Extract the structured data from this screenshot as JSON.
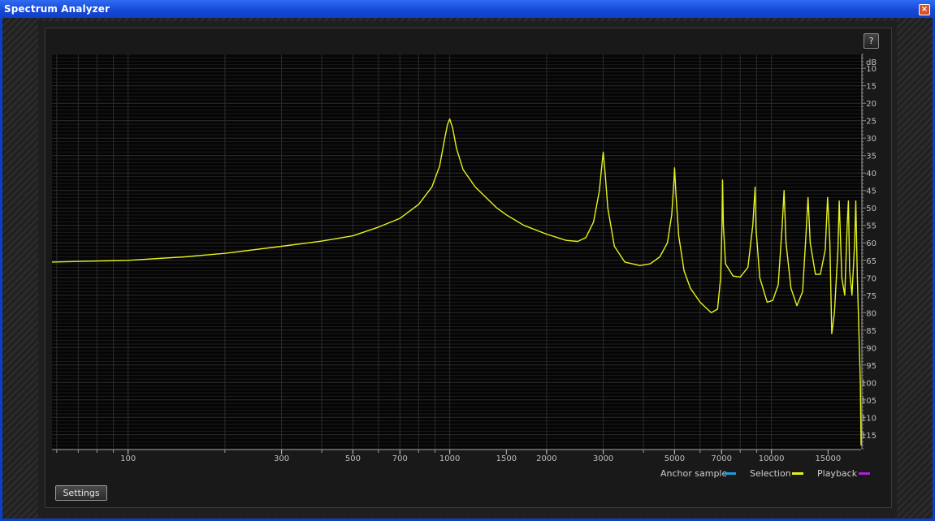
{
  "window": {
    "title": "Spectrum Analyzer",
    "close_label": "×"
  },
  "toolbar": {
    "help_label": "?"
  },
  "legend": [
    {
      "label": "Anchor sample",
      "color": "#1e9be0"
    },
    {
      "label": "Selection",
      "color": "#e6f21e"
    },
    {
      "label": "Playback",
      "color": "#b21ed6"
    }
  ],
  "footer": {
    "settings_label": "Settings"
  },
  "chart_data": {
    "type": "line",
    "xscale": "log",
    "xlim": [
      58,
      19000
    ],
    "ylim": [
      6,
      119
    ],
    "y_inverted": true,
    "ylabel": "dB",
    "grid": true,
    "x_ticks": [
      100,
      300,
      500,
      700,
      1000,
      1500,
      2000,
      3000,
      5000,
      7000,
      10000,
      15000
    ],
    "y_ticks": [
      10,
      15,
      20,
      25,
      30,
      35,
      40,
      45,
      50,
      55,
      60,
      65,
      70,
      75,
      80,
      85,
      90,
      95,
      100,
      105,
      110,
      115
    ],
    "series": [
      {
        "color": "#e6f21e",
        "points": [
          [
            58,
            65.5
          ],
          [
            100,
            65
          ],
          [
            150,
            64
          ],
          [
            200,
            63
          ],
          [
            300,
            61
          ],
          [
            400,
            59.5
          ],
          [
            500,
            58
          ],
          [
            600,
            55.5
          ],
          [
            700,
            53
          ],
          [
            800,
            49
          ],
          [
            880,
            44
          ],
          [
            930,
            38
          ],
          [
            965,
            30
          ],
          [
            985,
            26
          ],
          [
            1000,
            24.5
          ],
          [
            1020,
            27
          ],
          [
            1050,
            33
          ],
          [
            1100,
            39
          ],
          [
            1200,
            44
          ],
          [
            1400,
            50
          ],
          [
            1500,
            52
          ],
          [
            1700,
            55
          ],
          [
            2000,
            57.5
          ],
          [
            2300,
            59.3
          ],
          [
            2500,
            59.6
          ],
          [
            2650,
            58.5
          ],
          [
            2800,
            54
          ],
          [
            2920,
            45
          ],
          [
            2970,
            38
          ],
          [
            3000,
            34
          ],
          [
            3040,
            40
          ],
          [
            3100,
            50
          ],
          [
            3250,
            61
          ],
          [
            3500,
            65.5
          ],
          [
            3900,
            66.5
          ],
          [
            4200,
            66
          ],
          [
            4500,
            64
          ],
          [
            4750,
            60
          ],
          [
            4900,
            52
          ],
          [
            4980,
            42
          ],
          [
            5000,
            38.5
          ],
          [
            5050,
            46
          ],
          [
            5150,
            58
          ],
          [
            5350,
            68
          ],
          [
            5600,
            73
          ],
          [
            6000,
            77
          ],
          [
            6500,
            80
          ],
          [
            6800,
            79
          ],
          [
            6950,
            70
          ],
          [
            7020,
            55
          ],
          [
            7050,
            42
          ],
          [
            7090,
            55
          ],
          [
            7200,
            66
          ],
          [
            7600,
            69.5
          ],
          [
            8000,
            69.8
          ],
          [
            8450,
            67
          ],
          [
            8750,
            55
          ],
          [
            8900,
            44
          ],
          [
            8960,
            56
          ],
          [
            9200,
            70
          ],
          [
            9700,
            77
          ],
          [
            10100,
            76.5
          ],
          [
            10500,
            72
          ],
          [
            10800,
            55
          ],
          [
            10950,
            45
          ],
          [
            11100,
            60
          ],
          [
            11500,
            73
          ],
          [
            12000,
            78
          ],
          [
            12500,
            74
          ],
          [
            12800,
            58
          ],
          [
            13000,
            47
          ],
          [
            13200,
            60
          ],
          [
            13700,
            69
          ],
          [
            14200,
            69
          ],
          [
            14700,
            62
          ],
          [
            14950,
            47
          ],
          [
            15200,
            60
          ],
          [
            15400,
            86
          ],
          [
            15700,
            80
          ],
          [
            16100,
            62
          ],
          [
            16250,
            48
          ],
          [
            16550,
            70
          ],
          [
            16900,
            75
          ],
          [
            17200,
            55
          ],
          [
            17350,
            48
          ],
          [
            17500,
            68
          ],
          [
            17800,
            75
          ],
          [
            18150,
            60
          ],
          [
            18300,
            48
          ],
          [
            18500,
            70
          ],
          [
            18700,
            85
          ],
          [
            18900,
            100
          ],
          [
            19000,
            118
          ]
        ]
      }
    ]
  }
}
